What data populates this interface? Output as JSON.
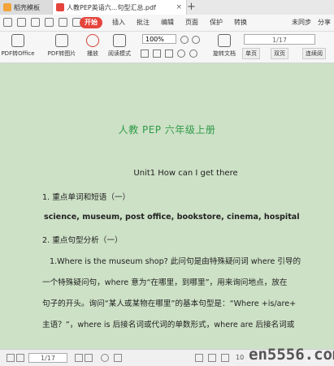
{
  "tabs": [
    {
      "label": "稻壳模板"
    },
    {
      "label": "人教PEP英语六...句型汇总.pdf"
    }
  ],
  "menu": {
    "items": [
      "开始",
      "插入",
      "批注",
      "编辑",
      "页面",
      "保护",
      "转换"
    ],
    "sync": "未同步",
    "share": "分享"
  },
  "toolbar": {
    "pdf_to_office": "PDF转Office",
    "pdf_to_image": "PDF转图片",
    "play": "播放",
    "read_mode": "阅读模式",
    "zoom": "100%",
    "page": "1/17",
    "rotate": "旋转文档",
    "single_page": "单页",
    "double_page": "双页",
    "continuous": "连续阅"
  },
  "document": {
    "title": "人教 PEP 六年级上册",
    "unit": "Unit1 How can I get there",
    "lines": [
      "1. 重点单词和短语（一）",
      "science, museum, post office, bookstore, cinema, hospital",
      "2. 重点句型分析（一）",
      "1.Where is the museum shop?  此问句是由特殊疑问词 where  引导的",
      "一个特殊疑问句，where 意为“在哪里，到哪里”，用来询问地点，放在",
      "句子的开头。询问“某人或某物在哪里”的基本句型是：“Where +is/are+",
      "主语？”，where is  后接名词或代词的单数形式，where are  后接名词或"
    ]
  },
  "status": {
    "page": "1/17",
    "zoom": "10"
  },
  "watermark": "en5556.com",
  "colors": {
    "accent": "#e5443c",
    "title_green": "#2f9a4a",
    "page_bg": "#cde1c6"
  }
}
